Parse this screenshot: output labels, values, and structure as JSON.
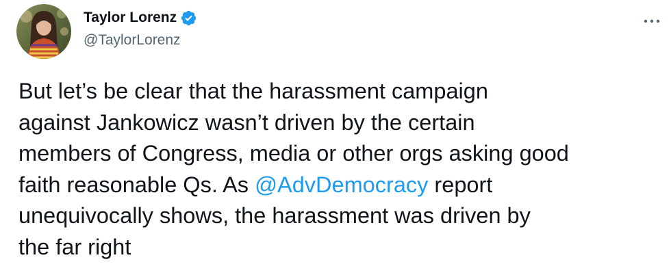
{
  "author": {
    "display_name": "Taylor Lorenz",
    "handle": "@TaylorLorenz",
    "avatar_icon": "profile-photo",
    "verified_icon": "verified-badge-icon",
    "verified_color": "#1d9bf0"
  },
  "menu": {
    "icon": "more-options-icon"
  },
  "tweet": {
    "lines": [
      {
        "segments": [
          {
            "text": "But let’s be clear that the harassment campaign",
            "type": "text"
          }
        ]
      },
      {
        "segments": [
          {
            "text": "against Jankowicz wasn’t driven by the certain",
            "type": "text"
          }
        ]
      },
      {
        "segments": [
          {
            "text": "members of Congress, media or other orgs asking good",
            "type": "text"
          }
        ]
      },
      {
        "segments": [
          {
            "text": "faith reasonable Qs. As ",
            "type": "text"
          },
          {
            "text": "@AdvDemocracy",
            "type": "mention"
          },
          {
            "text": " report",
            "type": "text"
          }
        ]
      },
      {
        "segments": [
          {
            "text": "unequivocally shows, the harassment was driven by",
            "type": "text"
          }
        ]
      },
      {
        "segments": [
          {
            "text": "the far right",
            "type": "text"
          }
        ]
      }
    ],
    "mention_color": "#1d9bf0",
    "text_color": "#0f1419"
  }
}
